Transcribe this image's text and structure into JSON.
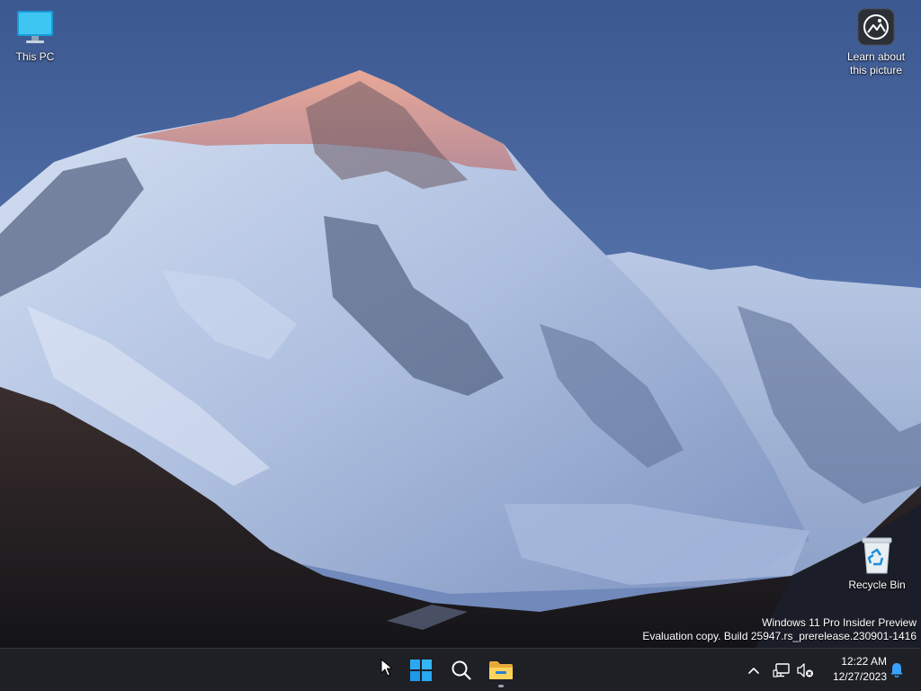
{
  "desktop": {
    "icons": [
      {
        "label": "This PC",
        "icon": "monitor-icon"
      },
      {
        "label": "Learn about this picture",
        "icon": "camera-spotlight-icon"
      },
      {
        "label": "Recycle Bin",
        "icon": "recycle-bin-icon"
      }
    ],
    "watermark": {
      "line1": "Windows 11 Pro Insider Preview",
      "line2": "Evaluation copy. Build 25947.rs_prerelease.230901-1416"
    }
  },
  "taskbar": {
    "apps": [
      {
        "name": "Start",
        "icon": "windows-logo-icon"
      },
      {
        "name": "Search",
        "icon": "search-icon"
      },
      {
        "name": "File Explorer",
        "icon": "folder-icon"
      }
    ],
    "tray": {
      "time": "12:22 AM",
      "date": "12/27/2023",
      "icons": [
        "chevron-up-icon",
        "network-icon",
        "volume-muted-icon",
        "notification-bell-icon"
      ]
    }
  },
  "colors": {
    "taskbar_bg": "#1f2025",
    "accent_blue": "#0078d4",
    "sky": "#4a6aa3",
    "alpenglow": "#e3a08f"
  }
}
